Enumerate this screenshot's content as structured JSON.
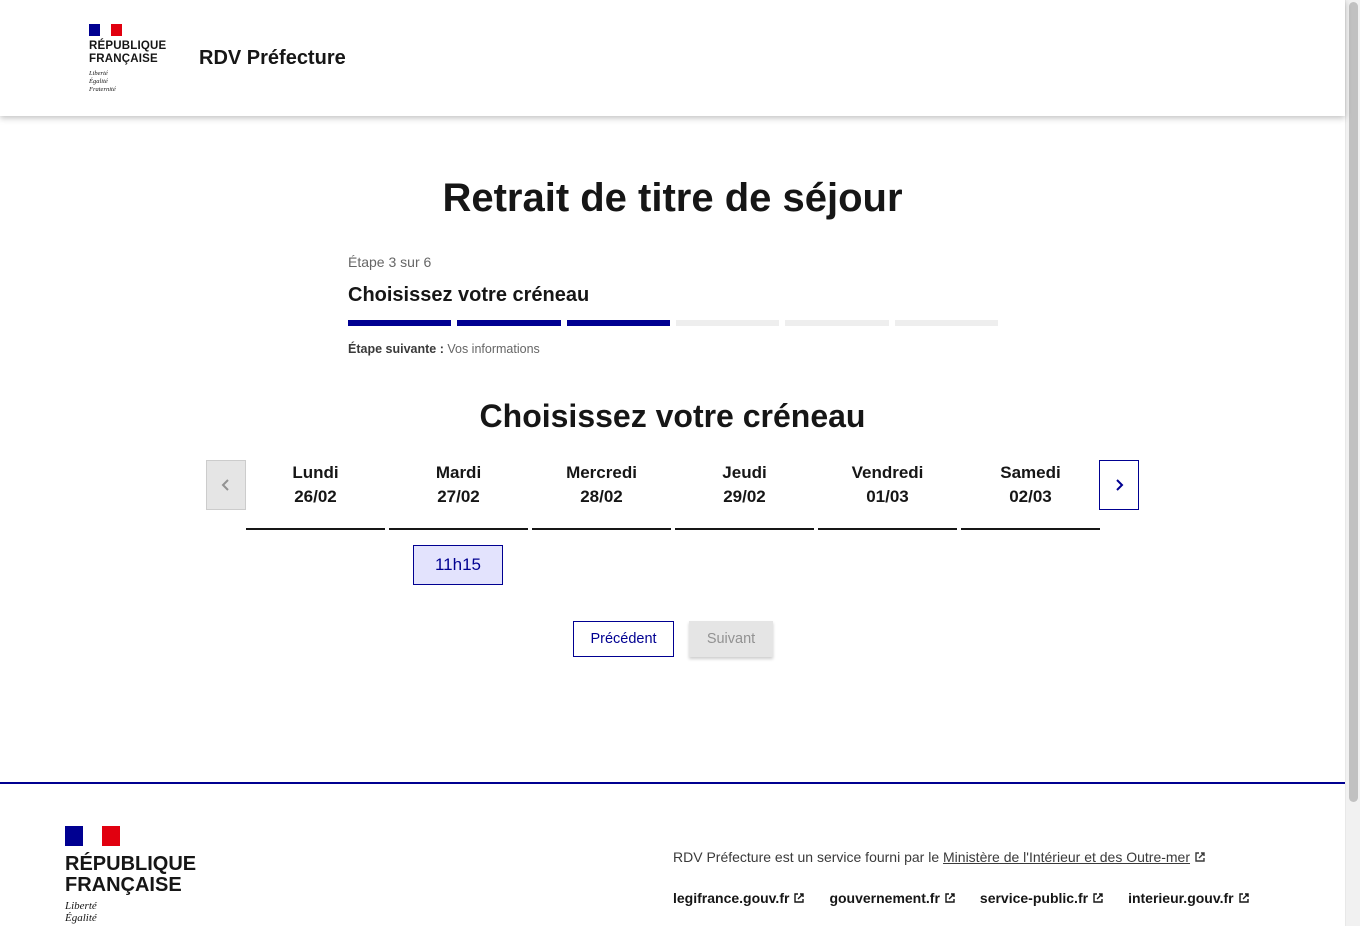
{
  "header": {
    "logo_text_line1": "RÉPUBLIQUE",
    "logo_text_line2": "FRANÇAISE",
    "motto_1": "Liberté",
    "motto_2": "Égalité",
    "motto_3": "Fraternité",
    "site_title": "RDV Préfecture"
  },
  "main": {
    "page_title": "Retrait de titre de séjour",
    "stepper": {
      "state": "Étape 3 sur 6",
      "title": "Choisissez votre créneau",
      "current_step": 3,
      "total_steps": 6,
      "next_label": "Étape suivante :",
      "next_value": "Vos informations"
    },
    "section_title": "Choisissez votre créneau",
    "days": [
      {
        "name": "Lundi",
        "date": "26/02"
      },
      {
        "name": "Mardi",
        "date": "27/02"
      },
      {
        "name": "Mercredi",
        "date": "28/02"
      },
      {
        "name": "Jeudi",
        "date": "29/02"
      },
      {
        "name": "Vendredi",
        "date": "01/03"
      },
      {
        "name": "Samedi",
        "date": "02/03"
      }
    ],
    "slots": [
      {
        "day": "Mardi 27/02",
        "time": "11h15",
        "selected": true
      }
    ],
    "buttons": {
      "previous": "Précédent",
      "next": "Suivant"
    }
  },
  "footer": {
    "logo_text_line1": "RÉPUBLIQUE",
    "logo_text_line2": "FRANÇAISE",
    "motto_1": "Liberté",
    "motto_2": "Égalité",
    "description_prefix": "RDV Préfecture est un service fourni par le ",
    "description_link": "Ministère de l'Intérieur et des Outre-mer",
    "links": [
      "legifrance.gouv.fr",
      "gouvernement.fr",
      "service-public.fr",
      "interieur.gouv.fr"
    ]
  },
  "colors": {
    "primary": "#000091",
    "flag_red": "#e1000f",
    "slot_selected_bg": "#e3e3fd",
    "disabled_bg": "#e5e5e5"
  }
}
